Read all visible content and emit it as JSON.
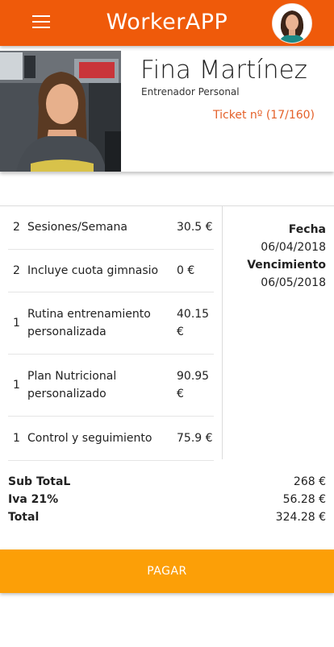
{
  "app": {
    "title": "WorkerAPP"
  },
  "profile": {
    "name": "Fina Martínez",
    "role": "Entrenador Personal",
    "ticket": "Ticket nº (17/160)"
  },
  "items": [
    {
      "qty": "2",
      "description": "Sesiones/Semana",
      "price": "30.5 €"
    },
    {
      "qty": "2",
      "description": "Incluye cuota gimnasio",
      "price": "0 €"
    },
    {
      "qty": "1",
      "description": "Rutina entrenamiento personalizada",
      "price": "40.15 €"
    },
    {
      "qty": "1",
      "description": "Plan Nutricional personalizado",
      "price": "90.95 €"
    },
    {
      "qty": "1",
      "description": "Control y seguimiento",
      "price": "75.9 €"
    }
  ],
  "dates": {
    "fecha_label": "Fecha",
    "fecha_value": "06/04/2018",
    "vencimiento_label": "Vencimiento",
    "vencimiento_value": "06/05/2018"
  },
  "totals": {
    "subtotal_label": "Sub TotaL",
    "subtotal_value": "268 €",
    "iva_label": "Iva 21%",
    "iva_value": "56.28 €",
    "total_label": "Total",
    "total_value": "324.28 €"
  },
  "pay_button": "PAGAR",
  "colors": {
    "appbar": "#ef5a0a",
    "ticket": "#e4612a",
    "pay": "#fc9f07"
  }
}
